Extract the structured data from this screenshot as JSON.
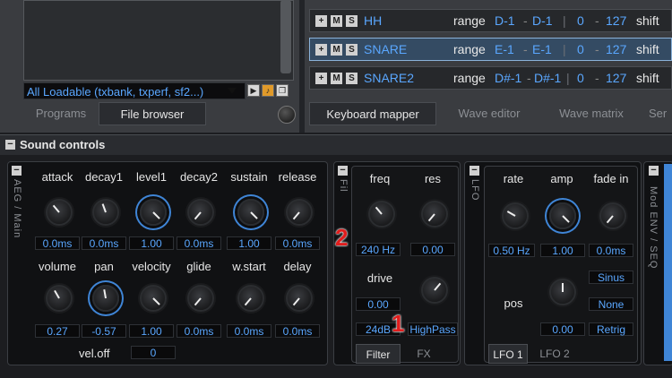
{
  "left_panel": {
    "loadable_label": "All Loadable (txbank, txperf, sf2...)",
    "tabs": [
      "Programs",
      "File browser"
    ]
  },
  "mapper": {
    "rows": [
      {
        "name": "HH",
        "range_label": "range",
        "lo": "D-1",
        "hi": "D-1",
        "vel_lo": "0",
        "vel_hi": "127",
        "shift_label": "shift"
      },
      {
        "name": "SNARE",
        "range_label": "range",
        "lo": "E-1",
        "hi": "E-1",
        "vel_lo": "0",
        "vel_hi": "127",
        "shift_label": "shift"
      },
      {
        "name": "SNARE2",
        "range_label": "range",
        "lo": "D#-1",
        "hi": "D#-1",
        "vel_lo": "0",
        "vel_hi": "127",
        "shift_label": "shift"
      }
    ],
    "tabs": [
      "Keyboard mapper",
      "Wave editor",
      "Wave matrix",
      "Ser"
    ]
  },
  "sound_controls": {
    "title": "Sound controls",
    "aeg_label": "AEG / Main",
    "row1_labels": [
      "attack",
      "decay1",
      "level1",
      "decay2",
      "sustain",
      "release"
    ],
    "row1_values": [
      "0.0ms",
      "0.0ms",
      "1.00",
      "0.0ms",
      "1.00",
      "0.0ms"
    ],
    "row2_labels": [
      "volume",
      "pan",
      "velocity",
      "glide",
      "w.start",
      "delay"
    ],
    "row2_values": [
      "0.27",
      "-0.57",
      "1.00",
      "0.0ms",
      "0.0ms",
      "0.0ms"
    ],
    "veloff_label": "vel.off",
    "veloff_value": "0"
  },
  "filter": {
    "side_label": "Fil",
    "freq_label": "freq",
    "res_label": "res",
    "freq_value": "240 Hz",
    "res_value": "0.00",
    "drive_label": "drive",
    "drive_value": "0.00",
    "slope_value": "24dB",
    "type_value": "HighPass",
    "tabs": [
      "Filter",
      "FX"
    ]
  },
  "lfo": {
    "side_label": "LFO",
    "rate_label": "rate",
    "amp_label": "amp",
    "fadein_label": "fade in",
    "rate_value": "0.50 Hz",
    "amp_value": "1.00",
    "fadein_value": "0.0ms",
    "pos_label": "pos",
    "pos_value": "0.00",
    "wave_value": "Sinus",
    "none_value": "None",
    "retrig_value": "Retrig",
    "tabs": [
      "LFO 1",
      "LFO 2"
    ]
  },
  "modenv": {
    "side_label": "Mod ENV / SEQ"
  },
  "markers": [
    "2",
    "1"
  ]
}
